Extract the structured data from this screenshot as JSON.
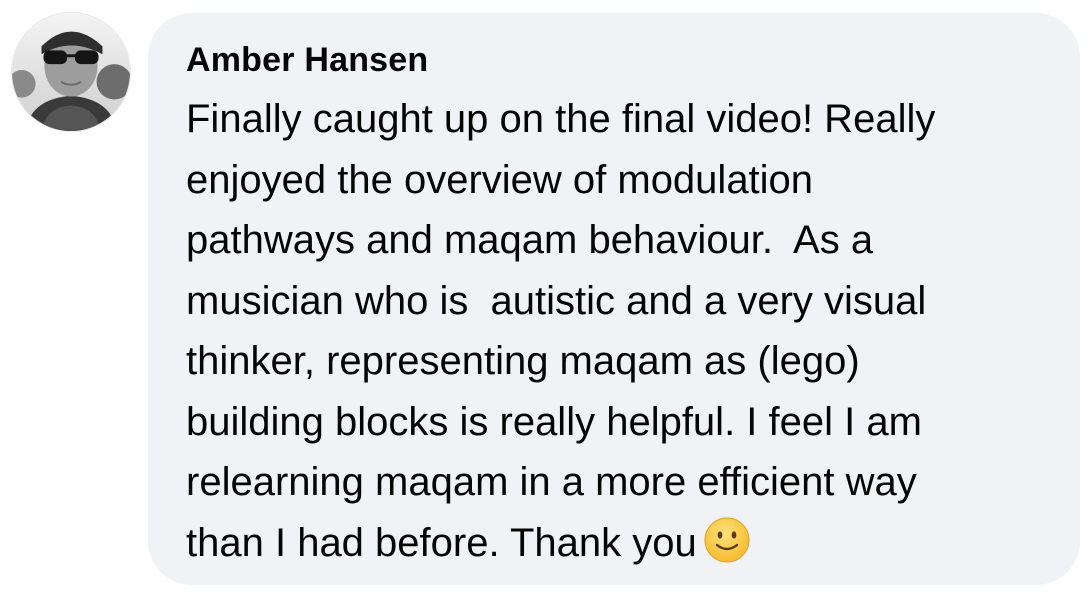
{
  "comment": {
    "author": "Amber Hansen",
    "lines": [
      "Finally caught up on the final video! Really",
      "enjoyed the overview of modulation",
      "pathways and maqam behaviour.  As a",
      "musician who is  autistic and a very visual",
      "thinker, representing maqam as (lego)",
      "building blocks is really helpful. I feel I am",
      "relearning maqam in a more efficient way",
      "than I had before. Thank you"
    ],
    "emoji": "slightly-smiling-face-icon"
  },
  "colors": {
    "bubble_background": "#f0f2f5",
    "text": "#050505"
  }
}
